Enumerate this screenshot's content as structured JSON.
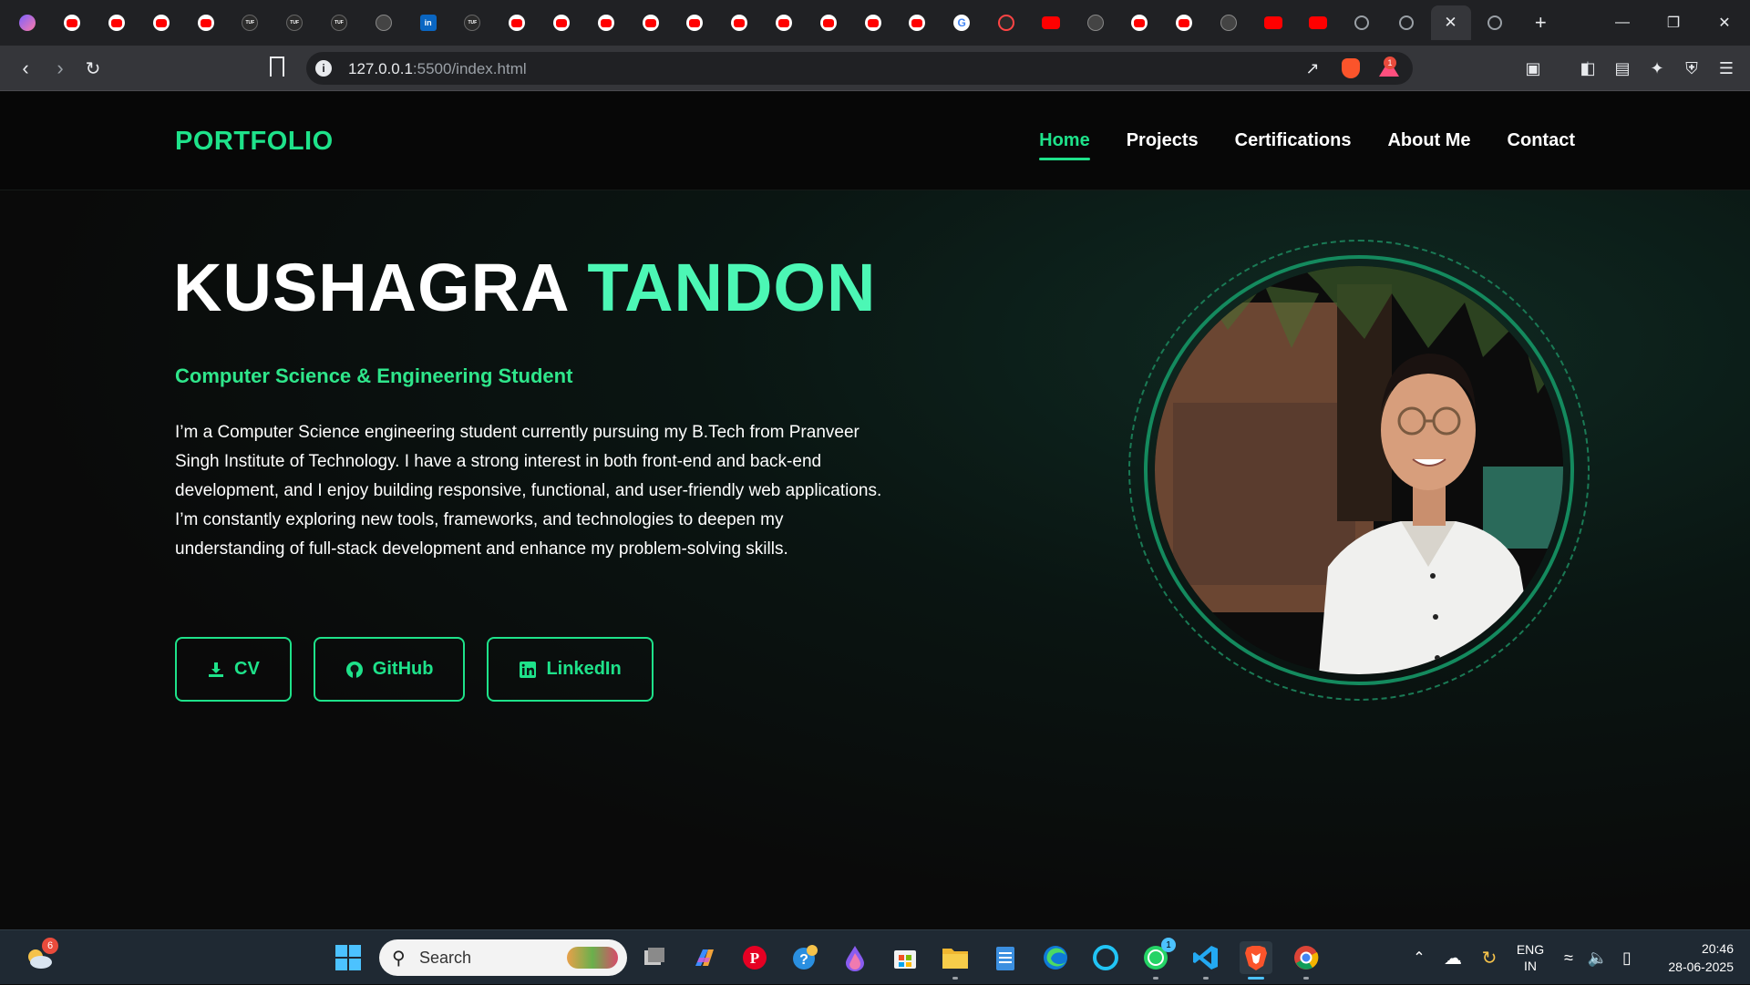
{
  "browser": {
    "tabs": [
      "av",
      "yt",
      "yt",
      "yt",
      "yt",
      "tuf",
      "tuf",
      "tuf",
      "gpt",
      "li",
      "tuf",
      "yt",
      "yt",
      "yt",
      "yt",
      "yt",
      "yt",
      "yt",
      "yt",
      "yt",
      "yt",
      "gg",
      "cc",
      "ytsq",
      "gpt",
      "yt",
      "yt",
      "gpt",
      "ytsq",
      "ytsq",
      "globe",
      "globe",
      "active",
      "globe"
    ],
    "new_tab_label": "+",
    "url_host": "127.0.0.1",
    "url_rest": ":5500/index.html",
    "notification_count": "1"
  },
  "site": {
    "logo": "PORTFOLIO",
    "nav": {
      "home": "Home",
      "projects": "Projects",
      "certifications": "Certifications",
      "about": "About Me",
      "contact": "Contact"
    },
    "hero": {
      "first_name": "KUSHAGRA",
      "last_name": "TANDON",
      "subtitle": "Computer Science & Engineering Student",
      "bio": "I’m a Computer Science engineering student currently pursuing my B.Tech from Pranveer Singh Institute of Technology. I have a strong interest in both front-end and back-end development, and I enjoy building responsive, functional, and user-friendly web applications. I’m constantly exploring new tools, frameworks, and technologies to deepen my understanding of full-stack development and enhance my problem-solving skills."
    },
    "buttons": {
      "cv": "CV",
      "github": "GitHub",
      "linkedin": "LinkedIn"
    },
    "accent_color": "#1ee28a"
  },
  "taskbar": {
    "weather_badge": "6",
    "search_placeholder": "Search",
    "whatsapp_badge": "1",
    "language_line1": "ENG",
    "language_line2": "IN",
    "time": "20:46",
    "date": "28-06-2025"
  }
}
